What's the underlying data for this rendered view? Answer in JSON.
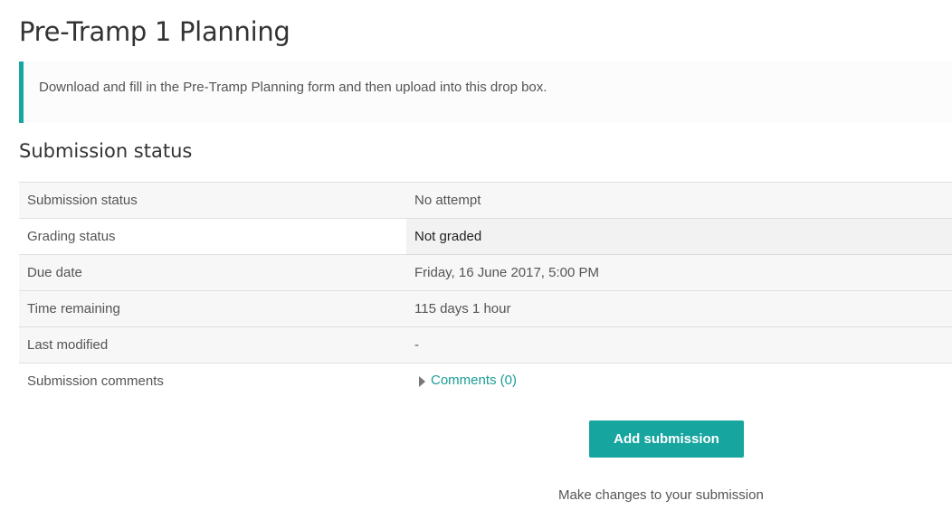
{
  "page": {
    "title": "Pre-Tramp 1 Planning",
    "intro": "Download and fill in the Pre-Tramp Planning form and then upload into this drop box."
  },
  "submission": {
    "heading": "Submission status",
    "rows": [
      {
        "label": "Submission status",
        "value": "No attempt"
      },
      {
        "label": "Grading status",
        "value": "Not graded"
      },
      {
        "label": "Due date",
        "value": "Friday, 16 June 2017, 5:00 PM"
      },
      {
        "label": "Time remaining",
        "value": "115 days 1 hour"
      },
      {
        "label": "Last modified",
        "value": "-"
      },
      {
        "label": "Submission comments",
        "value": "Comments (0)"
      }
    ]
  },
  "actions": {
    "add_submission_label": "Add submission",
    "help_text": "Make changes to your submission"
  },
  "colors": {
    "accent": "#17a5a0",
    "link": "#1a9c96"
  },
  "icons": {
    "comments_toggle": "triangle-right-icon"
  }
}
